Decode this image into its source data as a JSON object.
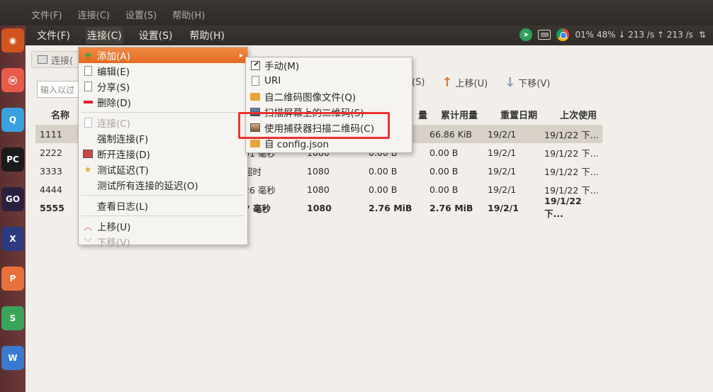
{
  "background_menu": [
    "文件(F)",
    "连接(C)",
    "设置(S)",
    "帮助(H)"
  ],
  "menubar": {
    "items": [
      "文件(F)",
      "连接(C)",
      "设置(S)",
      "帮助(H)"
    ],
    "active_index": 1
  },
  "indicators": {
    "stats": "01% 48% ↓ 213 /s ↑ 213 /s",
    "icons": [
      "telegram-icon",
      "keyboard-icon",
      "chrome-icon",
      "sort-icon"
    ]
  },
  "window": {
    "tab_label": "连接(",
    "search_placeholder": "输入以过",
    "toolbar": {
      "partial_label": "(S)",
      "move_up": "上移(U)",
      "move_down": "下移(V)"
    }
  },
  "table": {
    "headers": {
      "name": "名称",
      "usage_partial": "量",
      "total": "累计用量",
      "reset": "重置日期",
      "last": "上次使用"
    },
    "rows": [
      {
        "name": "1111",
        "lat": "",
        "port": "",
        "up": "",
        "total": "66.86 KiB",
        "reset": "19/2/1",
        "last": "19/1/22 下...",
        "selected": true,
        "bold": false
      },
      {
        "name": "2222",
        "lat": "01 毫秒",
        "port": "1080",
        "up": "0.00 B",
        "total": "0.00 B",
        "reset": "19/2/1",
        "last": "19/1/22 下...",
        "selected": false,
        "bold": false
      },
      {
        "name": "3333",
        "lat": "超时",
        "port": "1080",
        "up": "0.00 B",
        "total": "0.00 B",
        "reset": "19/2/1",
        "last": "19/1/22 下...",
        "selected": false,
        "bold": false
      },
      {
        "name": "4444",
        "lat": "26 毫秒",
        "port": "1080",
        "up": "0.00 B",
        "total": "0.00 B",
        "reset": "19/2/1",
        "last": "19/1/22 下...",
        "selected": false,
        "bold": false
      },
      {
        "name": "5555",
        "lat": "7 毫秒",
        "port": "1080",
        "up": "2.76 MiB",
        "total": "2.76 MiB",
        "reset": "19/2/1",
        "last": "19/1/22 下...",
        "selected": false,
        "bold": true
      }
    ]
  },
  "connection_menu": {
    "add": "添加(A)",
    "edit": "编辑(E)",
    "share": "分享(S)",
    "delete": "删除(D)",
    "connect": "连接(C)",
    "force_connect": "强制连接(F)",
    "disconnect": "断开连接(D)",
    "test_latency": "测试延迟(T)",
    "test_all_latency": "测试所有连接的延迟(O)",
    "view_log": "查看日志(L)",
    "move_up": "上移(U)",
    "move_down": "下移(V)"
  },
  "add_submenu": {
    "manual": "手动(M)",
    "uri": "URI",
    "from_qr_image": "自二维码图像文件(Q)",
    "scan_screen_qr": "扫描屏幕上的二维码(S)",
    "scan_with_capturer": "使用捕获器扫描二维码(C)",
    "from_config_json": "自 config.json"
  },
  "colors": {
    "highlight": "#e26b22",
    "annotation_box": "#e8342f",
    "menubar": "#302c29"
  }
}
